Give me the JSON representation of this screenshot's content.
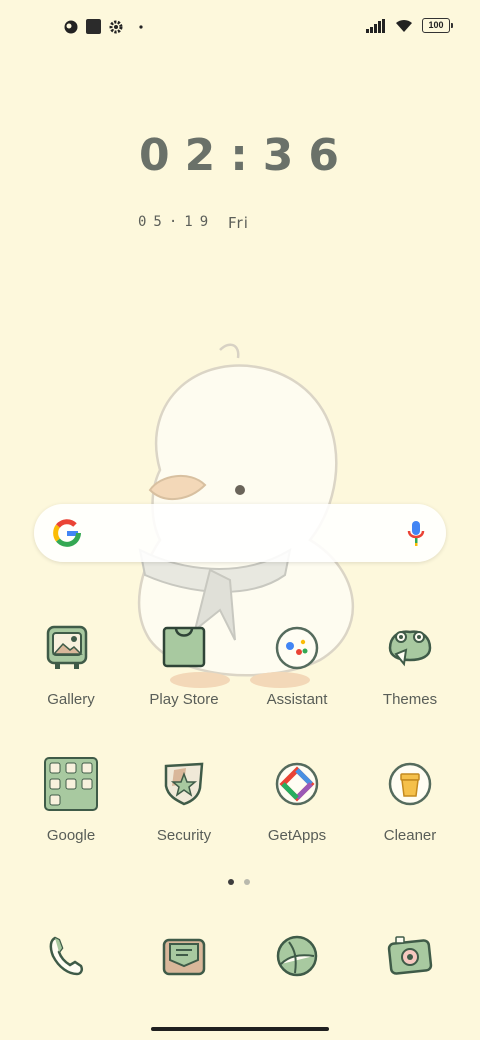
{
  "status_bar": {
    "battery": "100",
    "left_icons": [
      "theme-icon",
      "square-notification-icon",
      "settings-gear-icon",
      "dot-icon"
    ],
    "right_icons": [
      "signal-icon",
      "wifi-icon",
      "battery-icon"
    ]
  },
  "clock": {
    "time": "02:36",
    "date": "05·19",
    "day": "Fri"
  },
  "search_bar": {
    "icons": [
      "google-g-icon",
      "microphone-icon"
    ]
  },
  "apps_row1": [
    {
      "label": "Gallery",
      "icon": "gallery-icon"
    },
    {
      "label": "Play Store",
      "icon": "play-store-icon"
    },
    {
      "label": "Assistant",
      "icon": "assistant-icon"
    },
    {
      "label": "Themes",
      "icon": "themes-icon"
    }
  ],
  "apps_row2": [
    {
      "label": "Google",
      "icon": "google-folder-icon"
    },
    {
      "label": "Security",
      "icon": "security-icon"
    },
    {
      "label": "GetApps",
      "icon": "getapps-icon"
    },
    {
      "label": "Cleaner",
      "icon": "cleaner-icon"
    }
  ],
  "dock": [
    {
      "icon": "phone-icon"
    },
    {
      "icon": "messages-icon"
    },
    {
      "icon": "browser-icon"
    },
    {
      "icon": "camera-icon"
    }
  ],
  "page_indicator": {
    "current": 1,
    "total": 2
  },
  "colors": {
    "background": "#fdf8dc",
    "accent_green": "#a8c9a0",
    "outline": "#4e6b57"
  }
}
